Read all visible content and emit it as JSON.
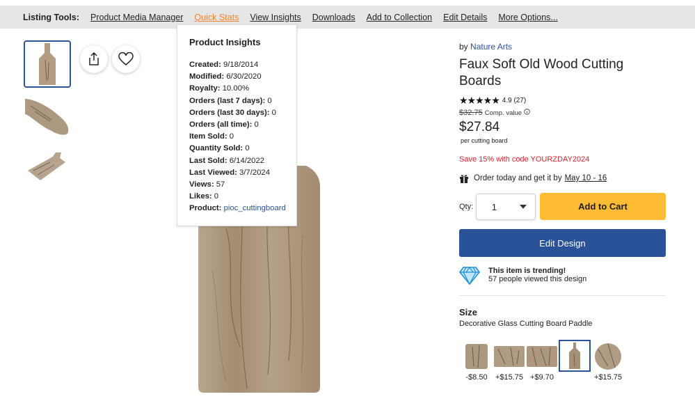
{
  "toolbar": {
    "label": "Listing Tools:",
    "links": [
      "Product Media Manager",
      "Quick Stats",
      "View Insights",
      "Downloads",
      "Add to Collection",
      "Edit Details",
      "More Options..."
    ]
  },
  "insights": {
    "title": "Product Insights",
    "rows": [
      {
        "label": "Created:",
        "value": "9/18/2014"
      },
      {
        "label": "Modified:",
        "value": "6/30/2020"
      },
      {
        "label": "Royalty:",
        "value": "10.00%"
      },
      {
        "label": "Orders (last 7 days):",
        "value": "0"
      },
      {
        "label": "Orders (last 30 days):",
        "value": "0"
      },
      {
        "label": "Orders (all time):",
        "value": "0"
      },
      {
        "label": "Item Sold:",
        "value": "0"
      },
      {
        "label": "Quantity Sold:",
        "value": "0"
      },
      {
        "label": "Last Sold:",
        "value": "6/14/2022"
      },
      {
        "label": "Last Viewed:",
        "value": "3/7/2024"
      },
      {
        "label": "Views:",
        "value": "57"
      },
      {
        "label": "Likes:",
        "value": "0"
      },
      {
        "label": "Product:",
        "value": "pioc_cuttingboard"
      }
    ]
  },
  "product": {
    "by_label": "by",
    "brand": "Nature Arts",
    "title": "Faux Soft Old Wood Cutting Boards",
    "stars": "★★★★★",
    "rating": "4.9 (27)",
    "comp_price": "$32.75",
    "comp_label": "Comp. value",
    "price": "$27.84",
    "unit": "per cutting board",
    "save": "Save 15% with code YOURZDAY2024",
    "order_text": "Order today and get it by",
    "order_dates": "May 10 - 16",
    "qty_label": "Qty:",
    "qty_value": "1",
    "add_to_cart": "Add to Cart",
    "edit_design": "Edit Design",
    "trend_title": "This item is trending!",
    "trend_sub": "57 people viewed this design",
    "size_heading": "Size",
    "size_selected": "Decorative Glass Cutting Board Paddle",
    "size_options": [
      {
        "price": "-$8.50"
      },
      {
        "price": "+$15.75"
      },
      {
        "price": "+$9.70"
      },
      {
        "price": ""
      },
      {
        "price": "+$15.75"
      }
    ]
  },
  "colors": {
    "accent": "#2a5298",
    "cart": "#fdbc33",
    "sale": "#d0232b",
    "active_tab": "#f0832a",
    "wood": "#a8927a"
  }
}
